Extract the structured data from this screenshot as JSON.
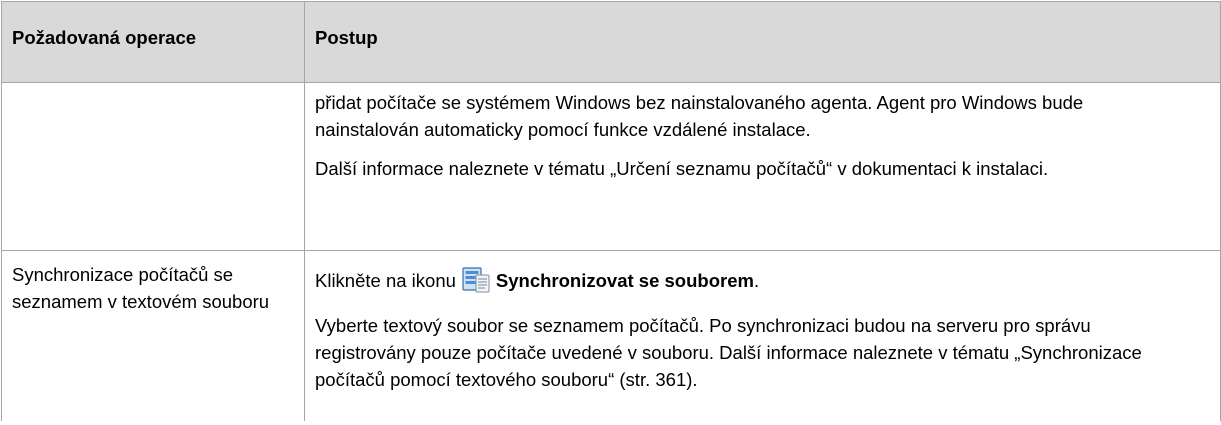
{
  "table": {
    "headers": [
      "Požadovaná operace",
      "Postup"
    ],
    "rows": [
      {
        "operation": "",
        "paragraphs": [
          "přidat počítače se systémem Windows bez nainstalovaného agenta. Agent pro Windows bude nainstalován automaticky pomocí funkce vzdálené instalace.",
          "Další informace naleznete v tématu „Určení seznamu počítačů“ v dokumentaci k instalaci."
        ]
      },
      {
        "operation": "Synchronizace počítačů se seznamem v textovém souboru",
        "step": {
          "prefix": "Klikněte na ikonu",
          "icon": "sync-with-file-icon",
          "action": "Synchronizovat se souborem",
          "suffix": "."
        },
        "paragraphs": [
          "Vyberte textový soubor se seznamem počítačů. Po synchronizaci budou na serveru pro správu registrovány pouze počítače uvedené v souboru. Další informace naleznete v tématu „Synchronizace počítačů pomocí textového souboru“ (str. 361)."
        ]
      }
    ]
  }
}
